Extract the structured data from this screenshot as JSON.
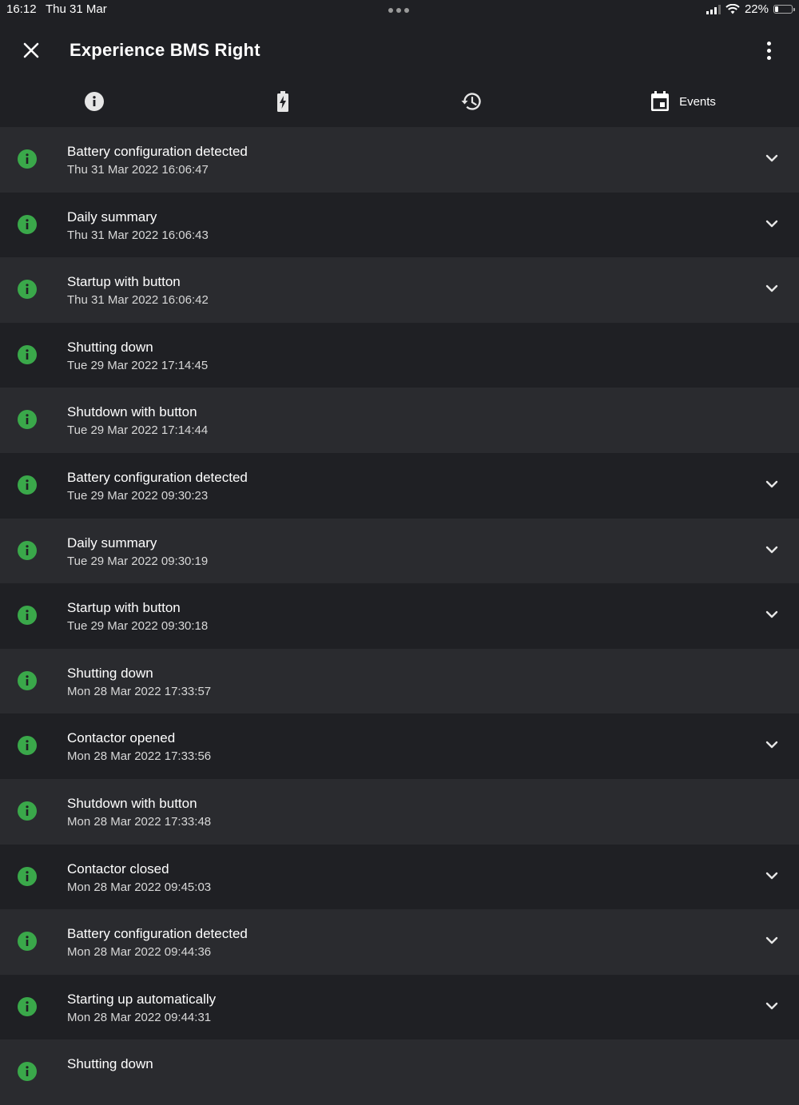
{
  "status_bar": {
    "time": "16:12",
    "date": "Thu 31 Mar",
    "battery_percent": "22%",
    "battery_level": 0.22
  },
  "header": {
    "title": "Experience BMS Right"
  },
  "tabs": [
    {
      "icon": "info-icon",
      "label": ""
    },
    {
      "icon": "battery-charging-icon",
      "label": ""
    },
    {
      "icon": "history-icon",
      "label": ""
    },
    {
      "icon": "calendar-icon",
      "label": "Events",
      "selected": true
    }
  ],
  "events": [
    {
      "title": "Battery configuration detected",
      "time": "Thu 31 Mar 2022 16:06:47",
      "expandable": true
    },
    {
      "title": "Daily summary",
      "time": "Thu 31 Mar 2022 16:06:43",
      "expandable": true
    },
    {
      "title": "Startup with button",
      "time": "Thu 31 Mar 2022 16:06:42",
      "expandable": true
    },
    {
      "title": "Shutting down",
      "time": "Tue 29 Mar 2022 17:14:45",
      "expandable": false
    },
    {
      "title": "Shutdown with button",
      "time": "Tue 29 Mar 2022 17:14:44",
      "expandable": false
    },
    {
      "title": "Battery configuration detected",
      "time": "Tue 29 Mar 2022 09:30:23",
      "expandable": true
    },
    {
      "title": "Daily summary",
      "time": "Tue 29 Mar 2022 09:30:19",
      "expandable": true
    },
    {
      "title": "Startup with button",
      "time": "Tue 29 Mar 2022 09:30:18",
      "expandable": true
    },
    {
      "title": "Shutting down",
      "time": "Mon 28 Mar 2022 17:33:57",
      "expandable": false
    },
    {
      "title": "Contactor opened",
      "time": "Mon 28 Mar 2022 17:33:56",
      "expandable": true
    },
    {
      "title": "Shutdown with button",
      "time": "Mon 28 Mar 2022 17:33:48",
      "expandable": false
    },
    {
      "title": "Contactor closed",
      "time": "Mon 28 Mar 2022 09:45:03",
      "expandable": true
    },
    {
      "title": "Battery configuration detected",
      "time": "Mon 28 Mar 2022 09:44:36",
      "expandable": true
    },
    {
      "title": "Starting up automatically",
      "time": "Mon 28 Mar 2022 09:44:31",
      "expandable": true
    },
    {
      "title": "Shutting down",
      "time": "",
      "expandable": false
    }
  ],
  "colors": {
    "background": "#1f2024",
    "row_alt": "#2a2b2f",
    "info_green": "#3aa84a"
  }
}
